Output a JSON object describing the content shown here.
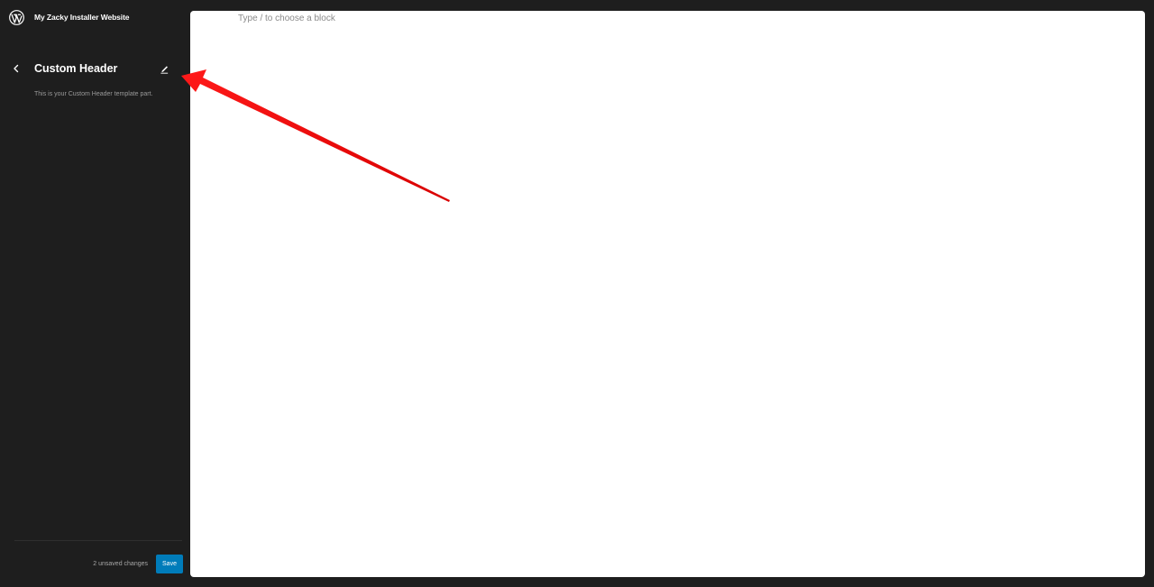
{
  "site": {
    "title": "My Zacky Installer Website",
    "logo_icon": "wordpress-logo-icon"
  },
  "template_part": {
    "back_icon": "chevron-left-icon",
    "title": "Custom Header",
    "edit_icon": "pencil-icon",
    "description": "This is your Custom Header template part."
  },
  "footer": {
    "unsaved_text": "2 unsaved changes",
    "save_label": "Save"
  },
  "editor": {
    "placeholder": "Type / to choose a block"
  },
  "annotation": {
    "arrow_icon": "red-arrow-icon",
    "color": "#e00000"
  },
  "colors": {
    "background": "#1e1e1e",
    "accent": "#007cba",
    "canvas": "#ffffff"
  }
}
